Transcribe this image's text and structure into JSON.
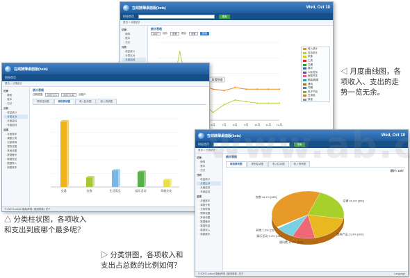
{
  "app": {
    "title": "在线随薄桌面版(beta)",
    "date": "Wed, Oct 10",
    "nav_item": "财经首页",
    "search_button": "搜索",
    "language_link": "Language",
    "copyright": "© 2007 Luduan  隐私声明 | 使用条款 | 关于"
  },
  "sidebar": {
    "groups": [
      {
        "label": "记录",
        "items": [
          "随笔",
          "账本",
          "日记"
        ]
      },
      {
        "label": "分析",
        "items": [
          "收益统计",
          "分类比对",
          "月度曲线",
          "年度曲线"
        ]
      },
      {
        "label": "选项",
        "items": [
          "月度账本",
          "调整分类",
          "方案转换",
          "预算设置",
          "其他设置",
          "数据备份",
          "数据恢复",
          "数据导入",
          "新建账本"
        ]
      }
    ]
  },
  "windows": {
    "monthly": {
      "breadcrumb": "首页 > 月度统计",
      "section_title": "统计表格",
      "filters": {
        "year": "2007",
        "month_label": "月份:",
        "member": "全家",
        "type_label": "项目:",
        "type": "全家",
        "query": "查询"
      },
      "legend": [
        "收入总计",
        "支出总计",
        "饮食",
        "工资",
        "交通",
        "娱乐",
        "人际关系",
        "家庭开支",
        "服装/鞋帽",
        "通讯",
        "书籍",
        "电子产品",
        "日用品",
        "其他"
      ],
      "callout": "查看数据",
      "chart_data": {
        "type": "line",
        "x": [
          "1月",
          "2月",
          "3月",
          "4月",
          "5月",
          "6月",
          "7月",
          "8月",
          "9月",
          "10月",
          "11月",
          "12月"
        ],
        "ylim": [
          0,
          100
        ],
        "series": [
          {
            "name": "收入总计",
            "color": "#f08c1e",
            "values": [
              28,
              33,
              38,
              35,
              45,
              40,
              38,
              42,
              40,
              40,
              40,
              40
            ]
          },
          {
            "name": "支出总计",
            "color": "#b8d23a",
            "values": [
              22,
              18,
              88,
              20,
              24,
              10,
              20,
              26,
              24,
              22,
              22,
              22
            ]
          }
        ]
      }
    },
    "category_bar": {
      "breadcrumb": "首页 > 分类统计",
      "section_title": "统计表格",
      "date_label": "日期范围:",
      "date_from": "2007-9-1",
      "date_to": "2007-9-30",
      "member_label": "分账户:",
      "tabs": [
        "类别柱状图",
        "类别饼状图",
        "收入柱状图",
        "收入饼状图"
      ],
      "active_tab": 1,
      "chart_data": {
        "type": "bar",
        "categories": [
          "交通",
          "饮食",
          "生活用品",
          "娱乐活动",
          "网络文化"
        ],
        "values": [
          96,
          14,
          24,
          22,
          10
        ],
        "colors": [
          "#f0b418",
          "#a8c838",
          "#78b8e8",
          "#58b048",
          "#e8e040"
        ],
        "ylim": [
          0,
          100
        ]
      }
    },
    "category_pie": {
      "breadcrumb": "首页 > 分类统计",
      "section_title": "统计表格",
      "tabs": [
        "类别饼状图",
        "类别柱状图",
        "收入柱状图",
        "收入饼状图"
      ],
      "active_tab": 0,
      "total_label": "总计: 1457",
      "chart_data": {
        "type": "pie",
        "labels": [
          "交通 24.9% [350]",
          "数码产品 21.4% [300]",
          "通讯费 11.4% [160]",
          "娱乐活动 9.4% [132]",
          "其他 1.0% [15]",
          "饮食 44.1% [620]"
        ],
        "values": [
          24.9,
          21.4,
          11.4,
          9.4,
          1.0,
          44.1
        ],
        "colors": [
          "#a8d02a",
          "#e8b820",
          "#f06878",
          "#78d0e0",
          "#ffffff",
          "#e89a28"
        ]
      }
    }
  },
  "captions": {
    "line": [
      "◁ 月度曲线图，各",
      "项收入、支出的走",
      "势一览无余。"
    ],
    "bar": [
      "△ 分类柱状图，各项收入",
      "和支出到底哪个最多呢？"
    ],
    "pie": [
      "▷ 分类饼图，各项收入和",
      "支出占总数的比例如何？"
    ]
  },
  "watermark": "www.ab.cn"
}
